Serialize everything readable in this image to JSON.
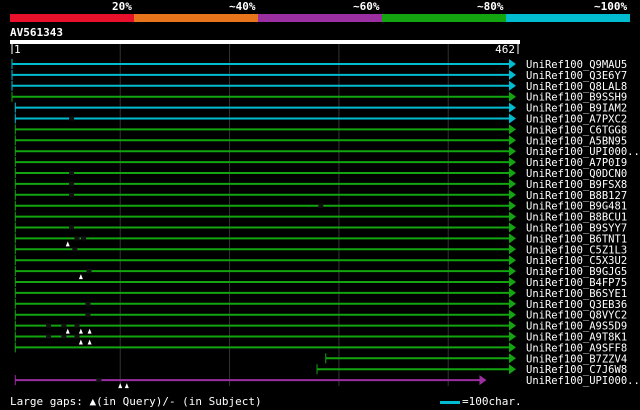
{
  "legend": {
    "labels": [
      "20%",
      "~40%",
      "~60%",
      "~80%",
      "~100%"
    ],
    "colors": [
      "#e8102a",
      "#e8741c",
      "#9b2ea0",
      "#13a50f",
      "#00bcd0"
    ]
  },
  "query": {
    "name": "AV561343",
    "start_label": "1",
    "end_label": "462"
  },
  "footer": {
    "gaps_label": "Large gaps: ▲(in Query)/- (in Subject)",
    "scale_label": "=100char."
  },
  "chart_data": {
    "type": "alignment",
    "query_length": 462,
    "axis": {
      "min": 1,
      "max": 462,
      "gridlines": [
        100,
        200,
        300,
        400
      ]
    },
    "hits": [
      {
        "name": "UniRef100_Q9MAU5",
        "start": 1,
        "end": 462,
        "color": "#00bcd0",
        "gaps_query": [],
        "gaps_subject": []
      },
      {
        "name": "UniRef100_Q3E6Y7",
        "start": 1,
        "end": 462,
        "color": "#00bcd0",
        "gaps_query": [],
        "gaps_subject": []
      },
      {
        "name": "UniRef100_Q8LAL8",
        "start": 1,
        "end": 462,
        "color": "#00bcd0",
        "gaps_query": [],
        "gaps_subject": []
      },
      {
        "name": "UniRef100_B9SSH9",
        "start": 1,
        "end": 462,
        "color": "#13a50f",
        "gaps_query": [],
        "gaps_subject": []
      },
      {
        "name": "UniRef100_B9IAM2",
        "start": 4,
        "end": 462,
        "color": "#00bcd0",
        "gaps_query": [],
        "gaps_subject": []
      },
      {
        "name": "UniRef100_A7PXC2",
        "start": 4,
        "end": 462,
        "color": "#00bcd0",
        "gaps_query": [],
        "gaps_subject": [
          55
        ]
      },
      {
        "name": "UniRef100_C6TGG8",
        "start": 4,
        "end": 462,
        "color": "#13a50f",
        "gaps_query": [],
        "gaps_subject": []
      },
      {
        "name": "UniRef100_A5BN95",
        "start": 4,
        "end": 462,
        "color": "#13a50f",
        "gaps_query": [],
        "gaps_subject": []
      },
      {
        "name": "UniRef100_UPI000..",
        "start": 4,
        "end": 462,
        "color": "#13a50f",
        "gaps_query": [],
        "gaps_subject": []
      },
      {
        "name": "UniRef100_A7P0I9",
        "start": 4,
        "end": 462,
        "color": "#13a50f",
        "gaps_query": [],
        "gaps_subject": []
      },
      {
        "name": "UniRef100_Q0DCN0",
        "start": 4,
        "end": 462,
        "color": "#13a50f",
        "gaps_query": [],
        "gaps_subject": [
          55
        ]
      },
      {
        "name": "UniRef100_B9FSX8",
        "start": 4,
        "end": 462,
        "color": "#13a50f",
        "gaps_query": [],
        "gaps_subject": [
          55
        ]
      },
      {
        "name": "UniRef100_B8B127",
        "start": 4,
        "end": 462,
        "color": "#13a50f",
        "gaps_query": [],
        "gaps_subject": [
          55
        ]
      },
      {
        "name": "UniRef100_B9G481",
        "start": 4,
        "end": 462,
        "color": "#13a50f",
        "gaps_query": [],
        "gaps_subject": [
          283
        ]
      },
      {
        "name": "UniRef100_B8BCU1",
        "start": 4,
        "end": 462,
        "color": "#13a50f",
        "gaps_query": [],
        "gaps_subject": []
      },
      {
        "name": "UniRef100_B9SYY7",
        "start": 4,
        "end": 462,
        "color": "#13a50f",
        "gaps_query": [],
        "gaps_subject": [
          55
        ]
      },
      {
        "name": "UniRef100_B6TNT1",
        "start": 4,
        "end": 462,
        "color": "#13a50f",
        "gaps_query": [
          52
        ],
        "gaps_subject": [
          60,
          66
        ]
      },
      {
        "name": "UniRef100_C5Z1L3",
        "start": 4,
        "end": 462,
        "color": "#13a50f",
        "gaps_query": [],
        "gaps_subject": [
          58
        ]
      },
      {
        "name": "UniRef100_C5X3U2",
        "start": 4,
        "end": 462,
        "color": "#13a50f",
        "gaps_query": [],
        "gaps_subject": []
      },
      {
        "name": "UniRef100_B9GJG5",
        "start": 4,
        "end": 462,
        "color": "#13a50f",
        "gaps_query": [
          64
        ],
        "gaps_subject": [
          71
        ]
      },
      {
        "name": "UniRef100_B4FP75",
        "start": 4,
        "end": 462,
        "color": "#13a50f",
        "gaps_query": [],
        "gaps_subject": []
      },
      {
        "name": "UniRef100_B6SYE1",
        "start": 4,
        "end": 462,
        "color": "#13a50f",
        "gaps_query": [],
        "gaps_subject": []
      },
      {
        "name": "UniRef100_Q3EB36",
        "start": 4,
        "end": 462,
        "color": "#13a50f",
        "gaps_query": [],
        "gaps_subject": [
          70
        ]
      },
      {
        "name": "UniRef100_Q8VYC2",
        "start": 4,
        "end": 462,
        "color": "#13a50f",
        "gaps_query": [],
        "gaps_subject": [
          70
        ]
      },
      {
        "name": "UniRef100_A9S5D9",
        "start": 4,
        "end": 462,
        "color": "#13a50f",
        "gaps_query": [
          52,
          64,
          72
        ],
        "gaps_subject": [
          34,
          48,
          60
        ]
      },
      {
        "name": "UniRef100_A9T8K1",
        "start": 4,
        "end": 462,
        "color": "#13a50f",
        "gaps_query": [
          64,
          72
        ],
        "gaps_subject": [
          34,
          48,
          60
        ]
      },
      {
        "name": "UniRef100_A9SFF8",
        "start": 4,
        "end": 462,
        "color": "#13a50f",
        "gaps_query": [],
        "gaps_subject": []
      },
      {
        "name": "UniRef100_B7ZZV4",
        "start": 288,
        "end": 462,
        "color": "#13a50f",
        "gaps_query": [],
        "gaps_subject": []
      },
      {
        "name": "UniRef100_C7J6W8",
        "start": 280,
        "end": 462,
        "color": "#13a50f",
        "gaps_query": [],
        "gaps_subject": []
      },
      {
        "name": "UniRef100_UPI000..",
        "start": 4,
        "end": 435,
        "color": "#9b2ea0",
        "gaps_query": [
          100,
          106
        ],
        "gaps_subject": [
          80
        ]
      }
    ]
  }
}
